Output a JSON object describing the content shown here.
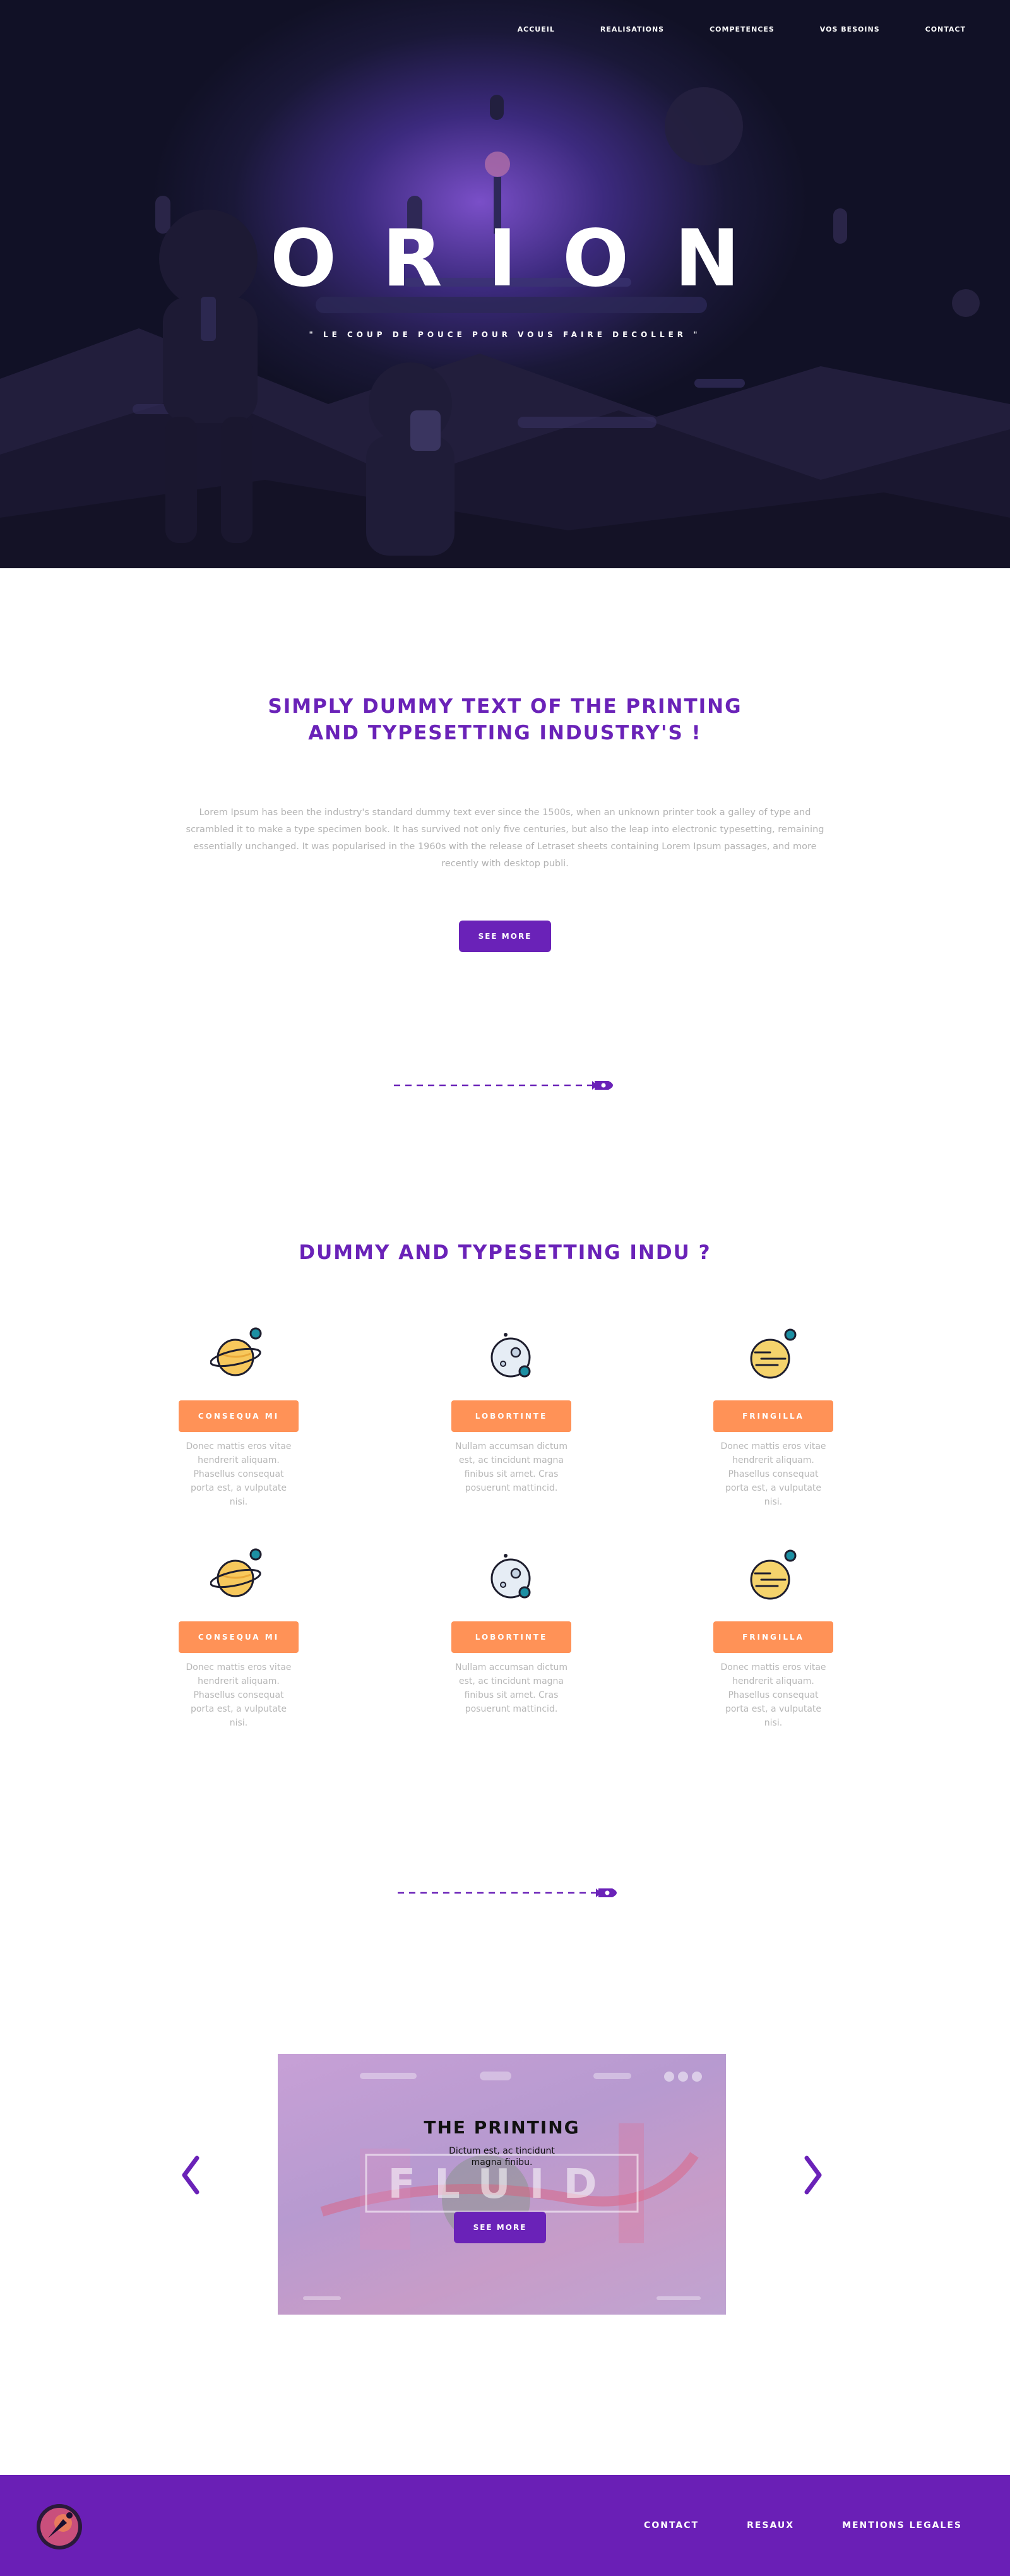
{
  "nav": {
    "items": [
      {
        "label": "ACCUEIL"
      },
      {
        "label": "REALISATIONS"
      },
      {
        "label": "COMPETENCES"
      },
      {
        "label": "VOS BESOINS"
      },
      {
        "label": "CONTACT"
      }
    ]
  },
  "hero": {
    "title": "ORION",
    "subtitle": "\" LE COUP DE POUCE POUR VOUS FAIRE DECOLLER \""
  },
  "intro": {
    "title_line1": "SIMPLY DUMMY TEXT OF THE PRINTING",
    "title_line2": "AND TYPESETTING INDUSTRY'S !",
    "text": "Lorem Ipsum has been the industry's standard dummy text ever since the 1500s, when an unknown printer took a galley of type and scrambled it to make a type specimen book. It has survived not only five centuries, but also the leap into electronic typesetting, remaining essentially unchanged. It was popularised in the 1960s with the release of Letraset sheets containing Lorem Ipsum passages, and more recently with desktop publi.",
    "button": "SEE MORE"
  },
  "services": {
    "title": "DUMMY AND TYPESETTING INDU ?",
    "cards": [
      {
        "label": "CONSEQUA MI",
        "text": "Donec mattis eros vitae hendrerit aliquam. Phasellus consequat porta est, a vulputate nisi.",
        "icon": "ringed-planet-icon"
      },
      {
        "label": "LOBORTINTE",
        "text": "Nullam accumsan dictum est, ac tincidunt magna finibus sit amet. Cras posuerunt mattincid.",
        "icon": "moon-planet-icon"
      },
      {
        "label": "FRINGILLA",
        "text": "Donec mattis eros vitae hendrerit aliquam. Phasellus consequat porta est, a vulputate nisi.",
        "icon": "striped-planet-icon"
      },
      {
        "label": "CONSEQUA MI",
        "text": "Donec mattis eros vitae hendrerit aliquam. Phasellus consequat porta est, a vulputate nisi.",
        "icon": "ringed-planet-icon"
      },
      {
        "label": "LOBORTINTE",
        "text": "Nullam accumsan dictum est, ac tincidunt magna finibus sit amet. Cras posuerunt mattincid.",
        "icon": "moon-planet-icon"
      },
      {
        "label": "FRINGILLA",
        "text": "Donec mattis eros vitae hendrerit aliquam. Phasellus consequat porta est, a vulputate nisi.",
        "icon": "striped-planet-icon"
      }
    ]
  },
  "slider": {
    "title": "THE PRINTING",
    "text": "Dictum est, ac tincidunt magna finibu.",
    "button": "SEE MORE",
    "background_word": "FLUID",
    "prev_icon": "chevron-left-icon",
    "next_icon": "chevron-right-icon"
  },
  "footer": {
    "links": [
      {
        "label": "CONTACT"
      },
      {
        "label": "RESAUX"
      },
      {
        "label": "MENTIONS LEGALES"
      }
    ]
  },
  "colors": {
    "brand_purple": "#6a22b8",
    "accent_orange": "#ff9257",
    "footer_purple": "#6a1fb6"
  }
}
